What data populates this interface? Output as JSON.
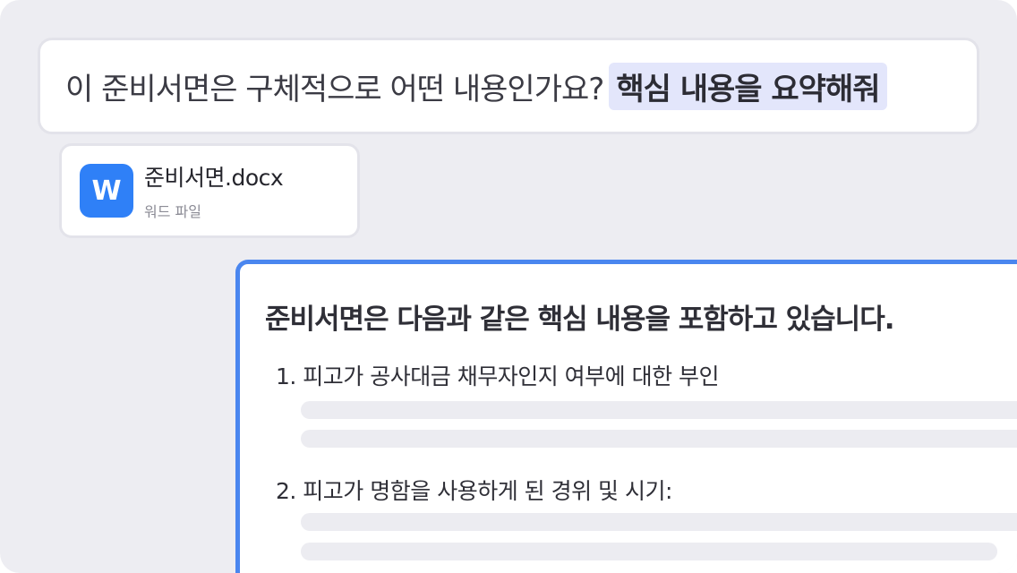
{
  "prompt": {
    "question": "이 준비서면은 구체적으로 어떤 내용인가요?",
    "highlight": "핵심 내용을 요약해줘"
  },
  "attachment": {
    "icon": "word-icon",
    "icon_letter": "W",
    "file_name": "준비서면.docx",
    "file_type": "워드 파일"
  },
  "answer": {
    "title": "준비서면은 다음과 같은 핵심 내용을 포함하고 있습니다.",
    "items": [
      {
        "label": "1. 피고가 공사대금 채무자인지 여부에 대한 부인"
      },
      {
        "label": "2.  피고가 명함을 사용하게 된 경위 및 시기:"
      }
    ]
  },
  "colors": {
    "background": "#ededf2",
    "accent": "#4a86ef",
    "highlight": "#e3e6fb",
    "word_blue": "#2f80f7"
  }
}
